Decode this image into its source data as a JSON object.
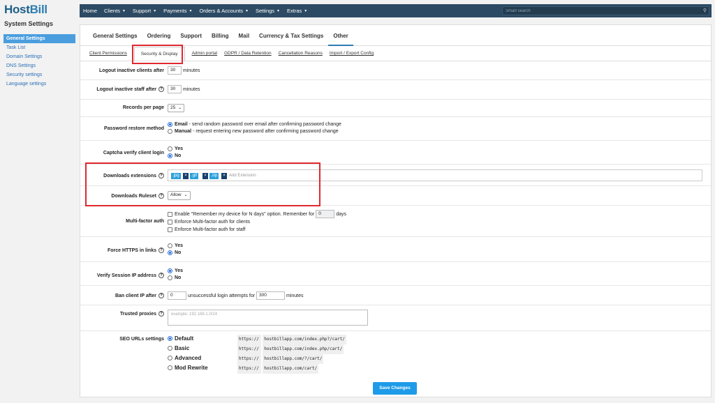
{
  "brand": {
    "host": "Host",
    "bill": "Bill"
  },
  "subtitle": "System Settings",
  "sidebar": {
    "items": [
      {
        "label": "General Settings"
      },
      {
        "label": "Task List"
      },
      {
        "label": "Domain Settings"
      },
      {
        "label": "DNS Settings"
      },
      {
        "label": "Security settings"
      },
      {
        "label": "Language settings"
      }
    ]
  },
  "topnav": {
    "items": [
      {
        "label": "Home"
      },
      {
        "label": "Clients"
      },
      {
        "label": "Support"
      },
      {
        "label": "Payments"
      },
      {
        "label": "Orders & Accounts"
      },
      {
        "label": "Settings"
      },
      {
        "label": "Extras"
      }
    ],
    "search_placeholder": "Smart search"
  },
  "tabs": [
    {
      "label": "General Settings"
    },
    {
      "label": "Ordering"
    },
    {
      "label": "Support"
    },
    {
      "label": "Billing"
    },
    {
      "label": "Mail"
    },
    {
      "label": "Currency & Tax Settings"
    },
    {
      "label": "Other"
    }
  ],
  "subtabs": [
    {
      "label": "Client Permissions"
    },
    {
      "label": "Security & Display"
    },
    {
      "label": "Admin portal"
    },
    {
      "label": "GDPR / Data Retention"
    },
    {
      "label": "Cancellation Reasons"
    },
    {
      "label": "Import / Export Config"
    }
  ],
  "settings": {
    "logout_clients": {
      "label": "Logout inactive clients after",
      "value": "30",
      "unit": "minutes"
    },
    "logout_staff": {
      "label": "Logout inactive staff after",
      "value": "30",
      "unit": "minutes"
    },
    "records": {
      "label": "Records per page",
      "value": "25"
    },
    "password_restore": {
      "label": "Password restore method",
      "opt1_title": "Email",
      "opt1_desc": " - send random password over email after confirming password change",
      "opt2_title": "Manual",
      "opt2_desc": " - request entering new password after confirming password change"
    },
    "captcha": {
      "label": "Captcha verify client login",
      "yes": "Yes",
      "no": "No"
    },
    "downloads_ext": {
      "label": "Downloads extensions",
      "tags": [
        ".jpg",
        ".gif",
        ".zip"
      ],
      "placeholder": "Add Extension",
      "remove": "×"
    },
    "downloads_ruleset": {
      "label": "Downloads Ruleset",
      "value": "Allow"
    },
    "mfa": {
      "label": "Multi-factor auth",
      "opt1": "Enable \"Remember my device for N days\" option. Remember for",
      "opt1_value": "0",
      "opt1_unit": "days",
      "opt2": "Enforce Multi-factor auth for clients",
      "opt3": "Enforce Multi-factor auth for staff"
    },
    "https": {
      "label": "Force HTTPS in links",
      "yes": "Yes",
      "no": "No"
    },
    "session_ip": {
      "label": "Verify Session IP address",
      "yes": "Yes",
      "no": "No"
    },
    "ban_ip": {
      "label": "Ban client IP after",
      "value1": "0",
      "text1": "unsuccessful login attempts for",
      "value2": "300",
      "text2": "minutes"
    },
    "proxies": {
      "label": "Trusted proxies",
      "placeholder": "example: 192.168.1.0/24"
    },
    "seo": {
      "label": "SEO URLs settings",
      "options": [
        {
          "name": "Default",
          "proto": "https://",
          "url": "hostbillapp.com/index.php?/cart/"
        },
        {
          "name": "Basic",
          "proto": "https://",
          "url": "hostbillapp.com/index.php/cart/"
        },
        {
          "name": "Advanced",
          "proto": "https://",
          "url": "hostbillapp.com/?/cart/"
        },
        {
          "name": "Mod Rewrite",
          "proto": "https://",
          "url": "hostbillapp.com/cart/"
        }
      ]
    }
  },
  "help_glyph": "?",
  "save_label": "Save Changes",
  "colors": {
    "nav": "#2c4a63",
    "accent": "#1e9be8",
    "highlight": "#e0282f",
    "tag": "#2ba0dd"
  }
}
